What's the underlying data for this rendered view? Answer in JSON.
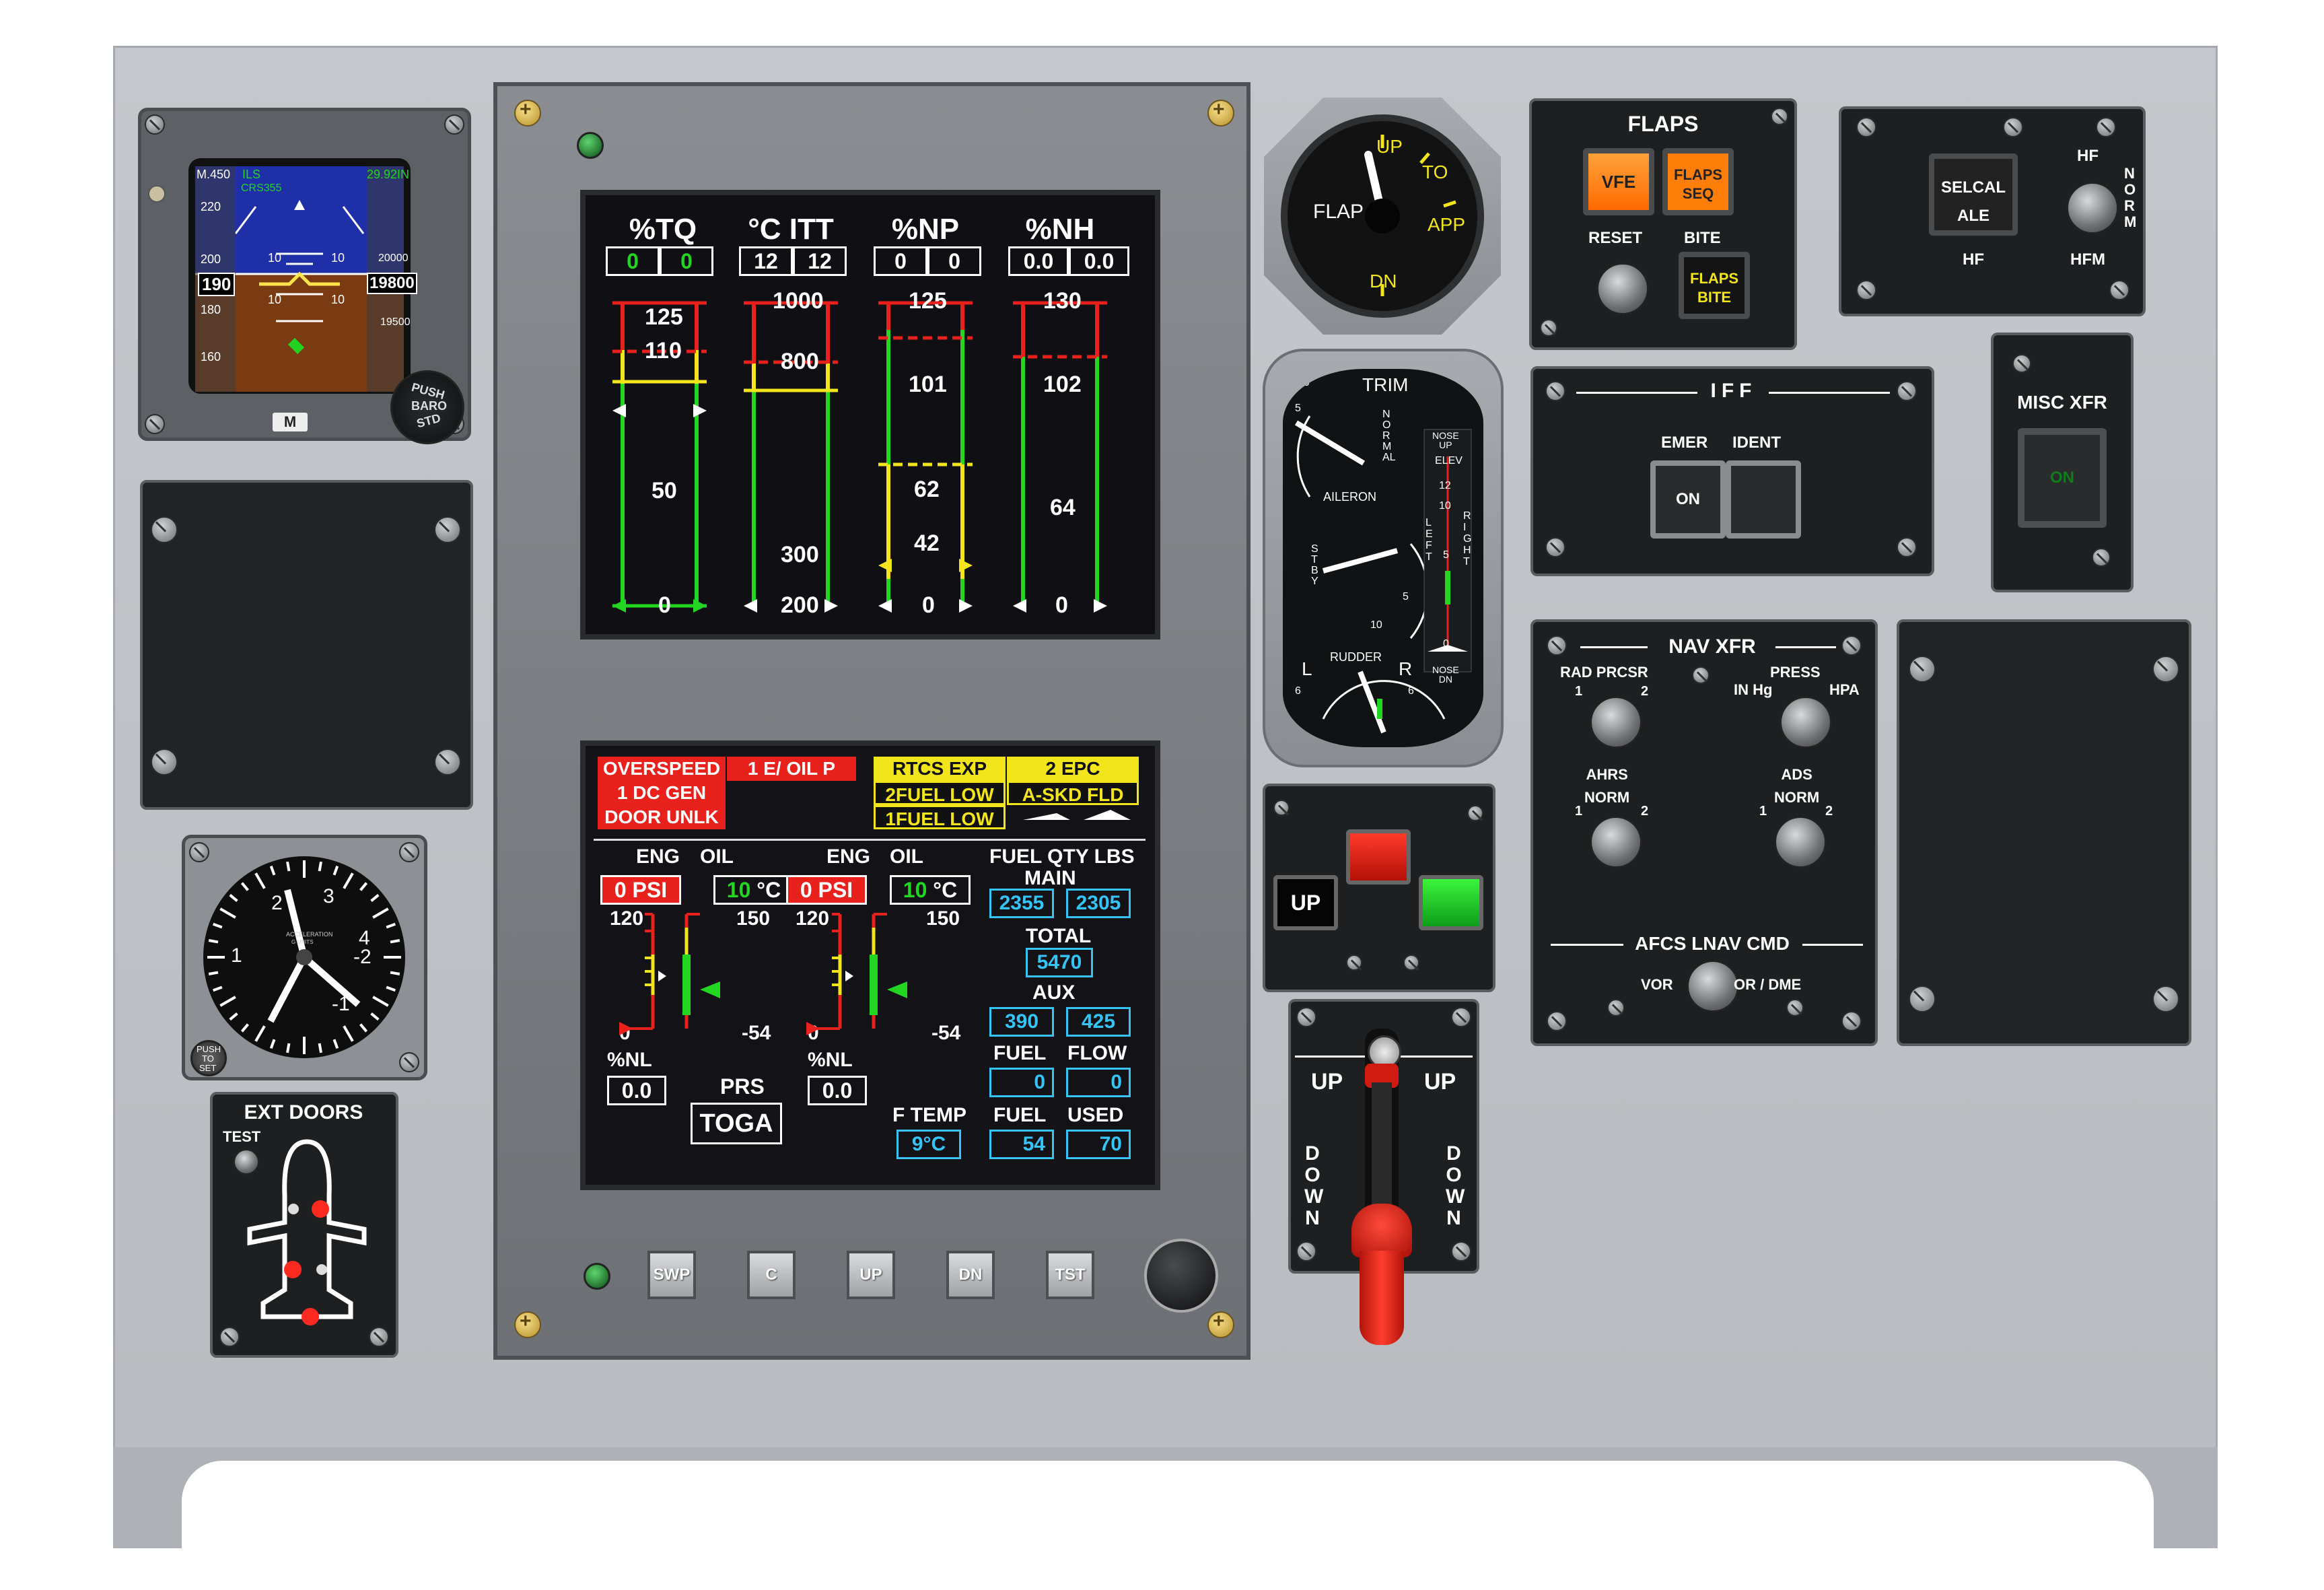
{
  "pfd": {
    "mach": "M.450",
    "mode": "ILS",
    "baro": "29.92IN",
    "course": "CRS355",
    "speed_ticks": [
      "220",
      "200",
      "180",
      "160"
    ],
    "speed_box": "190",
    "alt_ticks": [
      "20000",
      "19500"
    ],
    "alt_box": "19800",
    "pitch_labels": [
      "10",
      "10",
      "10",
      "10"
    ],
    "m_button": "M",
    "baro_knob": [
      "PUSH",
      "BARO",
      "STD"
    ]
  },
  "accel": {
    "scale": [
      "1",
      "2",
      "3",
      "4",
      "-1",
      "-2"
    ],
    "center": "ACCELERATION",
    "units": "G UNITS",
    "push_label": [
      "PUSH",
      "TO",
      "SET"
    ]
  },
  "ext_doors": {
    "title": "EXT DOORS",
    "test": "TEST"
  },
  "eis": {
    "headers": [
      "%TQ",
      "°C ITT",
      "%NP",
      "%NH"
    ],
    "readouts": [
      [
        "0",
        "0"
      ],
      [
        "12",
        "12"
      ],
      [
        "0",
        "0"
      ],
      [
        "0.0",
        "0.0"
      ]
    ],
    "scales": [
      [
        "125",
        "110",
        "50",
        "0"
      ],
      [
        "1000",
        "800",
        "300",
        "200"
      ],
      [
        "125",
        "101",
        "62",
        "42",
        "0"
      ],
      [
        "130",
        "102",
        "64",
        "0"
      ]
    ]
  },
  "cas": {
    "red": [
      "OVERSPEED",
      "1 E/ OIL P",
      "1 DC GEN",
      "DOOR UNLK"
    ],
    "yellow": [
      "RTCS EXP",
      "2 EPC",
      "2FUEL LOW",
      "A-SKD FLD",
      "1FUEL LOW"
    ]
  },
  "eng": {
    "oil_hdr_1": [
      "ENG",
      "OIL"
    ],
    "oil_hdr_2": [
      "ENG",
      "OIL"
    ],
    "psi": [
      [
        "0",
        "PSI"
      ],
      [
        "0",
        "PSI"
      ]
    ],
    "temp": [
      [
        "10",
        "°C"
      ],
      [
        "10",
        "°C"
      ]
    ],
    "scale_top": [
      [
        "120",
        "150"
      ],
      [
        "120",
        "150"
      ]
    ],
    "scale_bot": [
      [
        "0",
        "-54"
      ],
      [
        "0",
        "-54"
      ]
    ],
    "nl_label": "%NL",
    "nl": [
      "0.0",
      "0.0"
    ],
    "prs": "PRS",
    "toga": "TOGA",
    "fuel_qty": "FUEL QTY LBS",
    "main": "MAIN",
    "main_vals": [
      "2355",
      "2305"
    ],
    "total": "TOTAL",
    "total_val": "5470",
    "aux": "AUX",
    "aux_vals": [
      "390",
      "425"
    ],
    "fuel": "FUEL",
    "flow": "FLOW",
    "flow_vals": [
      "0",
      "0"
    ],
    "ftemp": "F TEMP",
    "ftemp_val": "9°C",
    "fuel2": "FUEL",
    "used": "USED",
    "used_vals": [
      "54",
      "70"
    ]
  },
  "display_buttons": [
    "SWP",
    "C",
    "UP",
    "DN",
    "TST"
  ],
  "flap_gauge": {
    "flap": "FLAP",
    "up": "UP",
    "to": "TO",
    "app": "APP",
    "dn": "DN"
  },
  "trim": {
    "title": "TRIM",
    "normal": "NORMAL",
    "stby": "STBY",
    "aileron": "AILERON",
    "rudder": "RUDDER",
    "nose_up": [
      "NOSE",
      "UP"
    ],
    "elev": "ELEV",
    "nose_dn": [
      "NOSE",
      "DN"
    ],
    "left": "LEFT",
    "right": "RIGHT",
    "elev_scale": [
      "12",
      "10",
      "5",
      "0"
    ],
    "ail_scale": [
      "10",
      "5",
      "5",
      "10"
    ],
    "rud_scale": [
      "6",
      "6"
    ],
    "l": "L",
    "r": "R"
  },
  "gear_lights": {
    "up": "UP"
  },
  "gear_handle": {
    "up": "UP",
    "down": "DOWN"
  },
  "flaps_panel": {
    "title": "FLAPS",
    "vfe": "VFE",
    "seq": [
      "FLAPS",
      "SEQ"
    ],
    "reset": "RESET",
    "bite_label": "BITE",
    "bite": [
      "FLAPS",
      "BITE"
    ]
  },
  "selcal": {
    "btn": [
      "SELCAL",
      "ALE"
    ],
    "hf_top": "HF",
    "norm": "NORM",
    "hf": "HF",
    "hfm": "HFM"
  },
  "iff": {
    "title": "IFF",
    "emer": "EMER",
    "ident": "IDENT",
    "on": "ON"
  },
  "misc_xfr": {
    "title": "MISC XFR",
    "state": "ON"
  },
  "nav_xfr": {
    "title": "NAV XFR",
    "rad": "RAD PRCSR",
    "press": "PRESS",
    "inhg": "IN Hg",
    "hpa": "HPA",
    "ahrs": [
      "AHRS",
      "NORM"
    ],
    "ads": [
      "ADS",
      "NORM"
    ],
    "one": "1",
    "two": "2",
    "afcs": "AFCS LNAV CMD",
    "vor": "VOR",
    "dme": "OR / DME"
  },
  "colors": {
    "green": "#22d622",
    "yellow": "#f2e51b",
    "red": "#e8211c",
    "cyan": "#36c3f5",
    "amber": "#ff8a00"
  }
}
